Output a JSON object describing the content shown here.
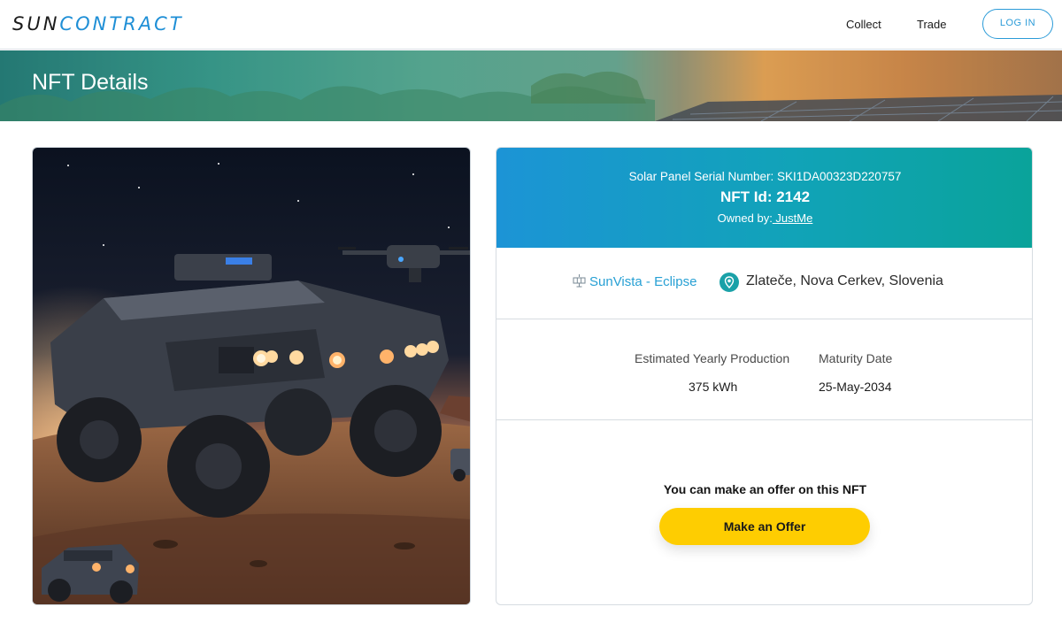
{
  "header": {
    "logo_sun": "SUN",
    "logo_contract": "CONTRACT",
    "nav": {
      "collect": "Collect",
      "trade": "Trade"
    },
    "login_label": "LOG IN"
  },
  "banner": {
    "title": "NFT Details"
  },
  "nft": {
    "serial_label": "Solar Panel Serial Number: SKI1DA00323D220757",
    "id_label": "NFT Id: 2142",
    "owned_by_label": "Owned by:",
    "owner": " JustMe",
    "project": "SunVista - Eclipse",
    "location": "Zlateče, Nova Cerkev, Slovenia",
    "stats": {
      "production_label": "Estimated Yearly Production",
      "production_value": "375 kWh",
      "maturity_label": "Maturity Date",
      "maturity_value": "25-May-2034"
    },
    "offer_text": "You can make an offer on this NFT",
    "offer_button": "Make an Offer"
  },
  "colors": {
    "brand_blue": "#1f8fd6",
    "accent_teal": "#1aa1a8",
    "offer_yellow": "#fecd01"
  },
  "icons": [
    "solar-panel-icon",
    "location-pin-icon"
  ]
}
